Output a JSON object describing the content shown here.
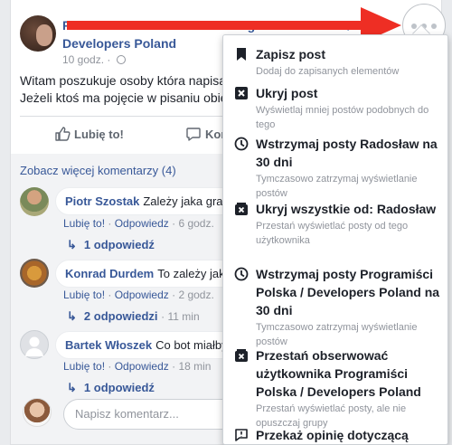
{
  "post": {
    "title": "Radosław Harbaszewski is Programiści Polska / Developers Poland",
    "time": "10 godz. ·",
    "text_line1": "Witam poszukuje osoby która napisa",
    "text_line2": "Jeżeli ktoś ma pojęcie w pisaniu obie",
    "like_label": "Lubię to!",
    "comment_label": "Kom"
  },
  "comments": {
    "more": "Zobacz więcej komentarzy (4)",
    "items": [
      {
        "author": "Piotr Szostak",
        "text": "Zależy jaka gra. N",
        "like": "Lubię to!",
        "reply": "Odpowiedz",
        "time": "6 godz.",
        "replies": "1 odpowiedź",
        "replies_time": ""
      },
      {
        "author": "Konrad Durdem",
        "text": "To zależy jaka",
        "like": "Lubię to!",
        "reply": "Odpowiedz",
        "time": "2 godz.",
        "replies": "2 odpowiedzi",
        "replies_time": "· 11 min"
      },
      {
        "author": "Bartek Włoszek",
        "text": "Co bot miałby",
        "like": "Lubię to!",
        "reply": "Odpowiedz",
        "time": "18 min",
        "replies": "1 odpowiedź",
        "replies_time": ""
      }
    ],
    "placeholder": "Napisz komentarz..."
  },
  "menu": {
    "items": [
      {
        "label": "Zapisz post",
        "sub": "Dodaj do zapisanych elementów",
        "icon": "bookmark-icon"
      },
      {
        "label": "Ukryj post",
        "sub": "Wyświetlaj mniej postów podobnych do tego",
        "icon": "hide-icon"
      },
      {
        "label": "Wstrzymaj posty Radosław na 30 dni",
        "sub": "Tymczasowo zatrzymaj wyświetlanie postów",
        "icon": "clock-icon"
      },
      {
        "label": "Ukryj wszystkie od: Radosław",
        "sub": "Przestań wyświetlać posty od tego użytkownika",
        "icon": "hide-all-icon"
      },
      {
        "label": "Wstrzymaj posty Programiści Polska / Developers Poland na 30 dni",
        "sub": "Tymczasowo zatrzymaj wyświetlanie postów",
        "icon": "clock-icon"
      },
      {
        "label": "Przestań obserwować użytkownika Programiści Polska / Developers Poland",
        "sub": "Przestań wyświetlać posty, ale nie opuszczaj grupy",
        "icon": "unfollow-icon"
      },
      {
        "label": "Przekaż opinię dotyczącą",
        "sub": "",
        "icon": "feedback-icon"
      }
    ]
  },
  "colors": {
    "link": "#385898",
    "arrow": "#ee2e24",
    "meta": "#90949c"
  }
}
